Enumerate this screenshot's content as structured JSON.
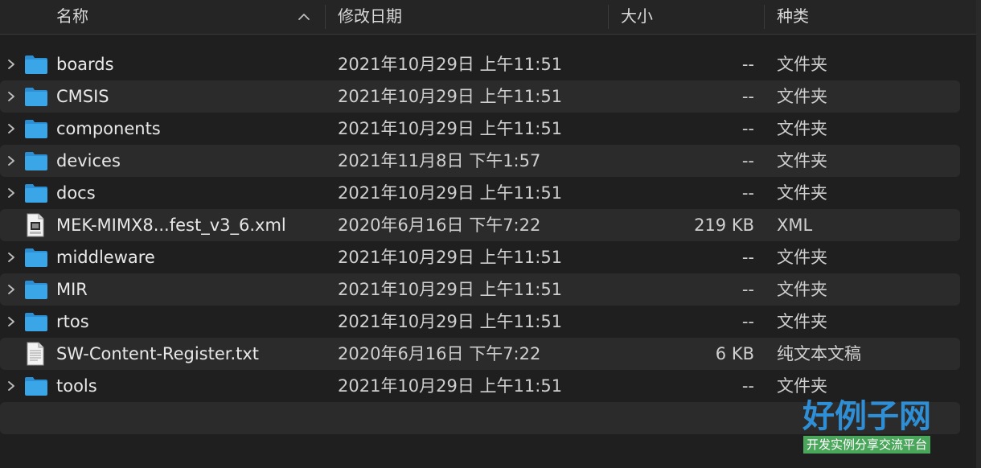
{
  "columns": {
    "name": "名称",
    "date": "修改日期",
    "size": "大小",
    "kind": "种类"
  },
  "colors": {
    "background": "#1f1f1f",
    "row_alt": "#2b2b2b",
    "folder": "#3aa6e8",
    "text": "#e3e3e3"
  },
  "rows": [
    {
      "name": "boards",
      "date": "2021年10月29日 上午11:51",
      "size": "--",
      "kind": "文件夹",
      "icon": "folder-icon",
      "expandable": true
    },
    {
      "name": "CMSIS",
      "date": "2021年10月29日 上午11:51",
      "size": "--",
      "kind": "文件夹",
      "icon": "folder-icon",
      "expandable": true
    },
    {
      "name": "components",
      "date": "2021年10月29日 上午11:51",
      "size": "--",
      "kind": "文件夹",
      "icon": "folder-icon",
      "expandable": true
    },
    {
      "name": "devices",
      "date": "2021年11月8日 下午1:57",
      "size": "--",
      "kind": "文件夹",
      "icon": "folder-icon",
      "expandable": true
    },
    {
      "name": "docs",
      "date": "2021年10月29日 上午11:51",
      "size": "--",
      "kind": "文件夹",
      "icon": "folder-icon",
      "expandable": true
    },
    {
      "name": "MEK-MIMX8...fest_v3_6.xml",
      "date": "2020年6月16日 下午7:22",
      "size": "219 KB",
      "kind": "XML",
      "icon": "xml-file-icon",
      "expandable": false
    },
    {
      "name": "middleware",
      "date": "2021年10月29日 上午11:51",
      "size": "--",
      "kind": "文件夹",
      "icon": "folder-icon",
      "expandable": true
    },
    {
      "name": "MIR",
      "date": "2021年10月29日 上午11:51",
      "size": "--",
      "kind": "文件夹",
      "icon": "folder-icon",
      "expandable": true
    },
    {
      "name": "rtos",
      "date": "2021年10月29日 上午11:51",
      "size": "--",
      "kind": "文件夹",
      "icon": "folder-icon",
      "expandable": true
    },
    {
      "name": "SW-Content-Register.txt",
      "date": "2020年6月16日 下午7:22",
      "size": "6 KB",
      "kind": "纯文本文稿",
      "icon": "text-file-icon",
      "expandable": false
    },
    {
      "name": "tools",
      "date": "2021年10月29日 上午11:51",
      "size": "--",
      "kind": "文件夹",
      "icon": "folder-icon",
      "expandable": true
    }
  ],
  "watermark": {
    "title": "好例子网",
    "subtitle": "开发实例分享交流平台"
  }
}
